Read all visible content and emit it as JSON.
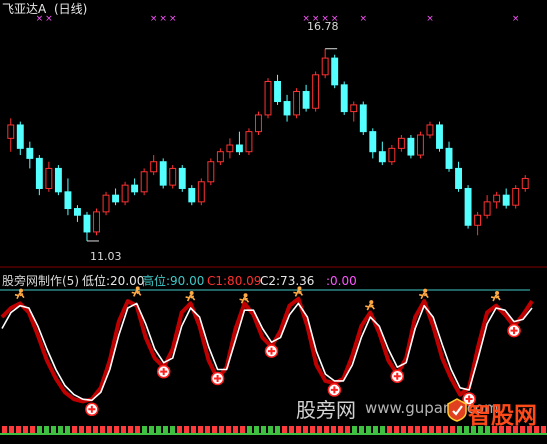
{
  "price_panel": {
    "title": "飞亚达A",
    "period": "(日线)",
    "high_annotation": "16.78",
    "low_annotation": "11.03"
  },
  "indicator_panel": {
    "name": "股旁网制作(5)",
    "low_level_label": "低位:20.00",
    "high_level_label": "高位:90.00",
    "c1_label": "C1:80.09",
    "c2_label": "C2:73.36",
    "extra_label": ":0.00"
  },
  "watermark": {
    "left_text": "股旁网",
    "url_text": "www.gupang.com",
    "brand_text": "智股网"
  },
  "colors": {
    "background": "#000000",
    "candle_up": "#ff3232",
    "candle_down": "#54ffff",
    "marker": "#ff55ff",
    "c1_line": "#c00000",
    "c2_line": "#ffffff",
    "level_line": "#40c8c8",
    "axis_text": "#c0c0c0",
    "buy_icon": "#ff2020",
    "sell_icon": "#ffaa44"
  },
  "chart_data": [
    {
      "type": "candlestick",
      "title": "飞亚达A (日线)",
      "annotations": [
        {
          "label": "16.78",
          "value": 16.78,
          "kind": "high"
        },
        {
          "label": "11.03",
          "value": 11.03,
          "kind": "low"
        }
      ],
      "ylim": [
        10.7,
        17.4
      ],
      "series": [
        {
          "values": [
            [
              14.1,
              14.7,
              13.7,
              14.5
            ],
            [
              14.5,
              14.6,
              13.6,
              13.8
            ],
            [
              13.8,
              14.0,
              13.2,
              13.5
            ],
            [
              13.5,
              13.6,
              12.4,
              12.6
            ],
            [
              12.6,
              13.4,
              12.5,
              13.2
            ],
            [
              13.2,
              13.3,
              12.4,
              12.5
            ],
            [
              12.5,
              12.9,
              11.8,
              12.0
            ],
            [
              12.0,
              12.1,
              11.6,
              11.8
            ],
            [
              11.8,
              11.9,
              11.03,
              11.3
            ],
            [
              11.3,
              12.0,
              11.2,
              11.9
            ],
            [
              11.9,
              12.5,
              11.8,
              12.4
            ],
            [
              12.4,
              12.6,
              12.1,
              12.2
            ],
            [
              12.2,
              12.8,
              12.1,
              12.7
            ],
            [
              12.7,
              12.9,
              12.4,
              12.5
            ],
            [
              12.5,
              13.2,
              12.4,
              13.1
            ],
            [
              13.1,
              13.6,
              13.0,
              13.4
            ],
            [
              13.4,
              13.5,
              12.6,
              12.7
            ],
            [
              12.7,
              13.3,
              12.6,
              13.2
            ],
            [
              13.2,
              13.3,
              12.5,
              12.6
            ],
            [
              12.6,
              12.7,
              12.1,
              12.2
            ],
            [
              12.2,
              12.9,
              12.1,
              12.8
            ],
            [
              12.8,
              13.5,
              12.7,
              13.4
            ],
            [
              13.4,
              13.8,
              13.3,
              13.7
            ],
            [
              13.7,
              14.1,
              13.5,
              13.9
            ],
            [
              13.9,
              14.3,
              13.6,
              13.7
            ],
            [
              13.7,
              14.4,
              13.6,
              14.3
            ],
            [
              14.3,
              14.9,
              14.2,
              14.8
            ],
            [
              14.8,
              15.9,
              14.7,
              15.8
            ],
            [
              15.8,
              16.0,
              15.1,
              15.2
            ],
            [
              15.2,
              15.4,
              14.6,
              14.8
            ],
            [
              14.8,
              15.6,
              14.7,
              15.5
            ],
            [
              15.5,
              15.7,
              14.9,
              15.0
            ],
            [
              15.0,
              16.1,
              14.9,
              16.0
            ],
            [
              16.0,
              16.78,
              15.9,
              16.5
            ],
            [
              16.5,
              16.6,
              15.6,
              15.7
            ],
            [
              15.7,
              15.8,
              14.8,
              14.9
            ],
            [
              14.9,
              15.2,
              14.6,
              15.1
            ],
            [
              15.1,
              15.2,
              14.2,
              14.3
            ],
            [
              14.3,
              14.4,
              13.5,
              13.7
            ],
            [
              13.7,
              14.0,
              13.3,
              13.4
            ],
            [
              13.4,
              13.9,
              13.3,
              13.8
            ],
            [
              13.8,
              14.2,
              13.7,
              14.1
            ],
            [
              14.1,
              14.2,
              13.5,
              13.6
            ],
            [
              13.6,
              14.3,
              13.5,
              14.2
            ],
            [
              14.2,
              14.6,
              14.1,
              14.5
            ],
            [
              14.5,
              14.6,
              13.7,
              13.8
            ],
            [
              13.8,
              14.0,
              13.1,
              13.2
            ],
            [
              13.2,
              13.4,
              12.5,
              12.6
            ],
            [
              12.6,
              12.7,
              11.4,
              11.5
            ],
            [
              11.5,
              11.9,
              11.2,
              11.8
            ],
            [
              11.8,
              12.4,
              11.7,
              12.2
            ],
            [
              12.2,
              12.5,
              12.0,
              12.4
            ],
            [
              12.4,
              12.6,
              12.0,
              12.1
            ],
            [
              12.1,
              12.7,
              12.0,
              12.6
            ],
            [
              12.6,
              13.0,
              12.5,
              12.9
            ]
          ]
        }
      ]
    },
    {
      "type": "line",
      "title": "股旁网制作(5)",
      "ylim": [
        0,
        100
      ],
      "levels": [
        {
          "label": "低位",
          "value": 20.0
        },
        {
          "label": "高位",
          "value": 90.0
        }
      ],
      "series": [
        {
          "name": "C1",
          "last": 80.09,
          "values": [
            78,
            86,
            90,
            82,
            62,
            40,
            24,
            12,
            6,
            4,
            6,
            16,
            40,
            74,
            92,
            88,
            60,
            42,
            34,
            50,
            82,
            90,
            70,
            40,
            24,
            34,
            68,
            90,
            80,
            60,
            52,
            66,
            88,
            94,
            70,
            36,
            22,
            20,
            24,
            44,
            70,
            82,
            64,
            40,
            28,
            42,
            78,
            92,
            70,
            42,
            24,
            10,
            16,
            52,
            82,
            88,
            80,
            70,
            80,
            92
          ]
        },
        {
          "name": "C2",
          "last": 73.36,
          "values": [
            68,
            82,
            88,
            86,
            70,
            50,
            32,
            18,
            10,
            6,
            5,
            12,
            32,
            62,
            86,
            90,
            72,
            50,
            38,
            42,
            70,
            86,
            78,
            52,
            32,
            32,
            58,
            84,
            84,
            68,
            56,
            60,
            80,
            90,
            78,
            48,
            28,
            22,
            22,
            36,
            60,
            78,
            70,
            50,
            34,
            38,
            68,
            88,
            78,
            54,
            32,
            16,
            14,
            42,
            72,
            86,
            84,
            74,
            76,
            86
          ]
        }
      ]
    }
  ]
}
